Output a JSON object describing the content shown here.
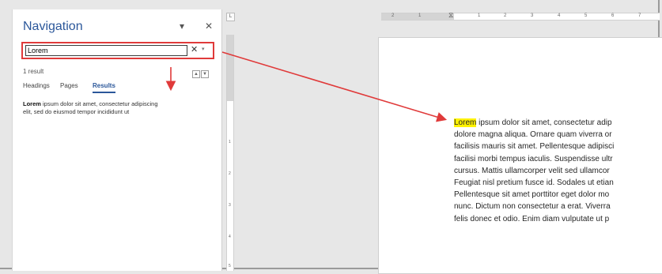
{
  "nav": {
    "title": "Navigation",
    "search_value": "Lorem",
    "result_count": "1 result",
    "tabs": [
      "Headings",
      "Pages",
      "Results"
    ],
    "active_tab": "Results",
    "result_match": "Lorem",
    "result_line1_rest": " ipsum dolor sit amet, consectetur adipiscing",
    "result_line2": "elit, sed do eiusmod tempor incididunt ut"
  },
  "ruler_corner": "L",
  "hruler_numbers": [
    "2",
    "1",
    "1",
    "2",
    "3",
    "4",
    "5",
    "6",
    "7"
  ],
  "vruler_numbers": [
    "1",
    "2",
    "3",
    "4",
    "5"
  ],
  "document": {
    "highlight": "Lorem",
    "line1_rest": " ipsum dolor sit amet, consectetur adip",
    "lines": [
      "dolore magna aliqua. Ornare quam viverra or",
      "facilisis mauris sit amet. Pellentesque adipisci",
      "facilisi morbi tempus iaculis. Suspendisse ultr",
      "cursus. Mattis ullamcorper velit sed ullamcor",
      "Feugiat nisl pretium fusce id. Sodales ut etian",
      "Pellentesque sit amet porttitor eget dolor mo",
      "nunc. Dictum non consectetur a erat. Viverra",
      "felis donec et odio. Enim diam vulputate ut p"
    ]
  },
  "colors": {
    "accent": "#2b579a",
    "annotation": "#e03a3a",
    "highlight": "#fff200"
  }
}
